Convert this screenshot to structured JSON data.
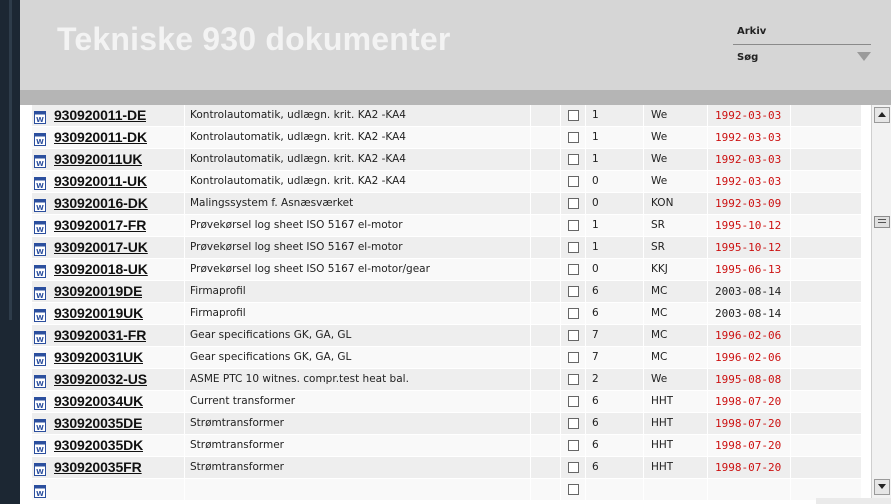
{
  "header": {
    "title": "Tekniske 930 dokumenter",
    "menu": [
      {
        "label": "Arkiv"
      },
      {
        "label": "Søg"
      }
    ]
  },
  "colors": {
    "date_old": "#cc1111",
    "date_new": "#222222",
    "header_bg": "#d6d6d6"
  },
  "documents": [
    {
      "num": "930920011-DE",
      "desc": "Kontrolautomatik, udlægn. krit. KA2 -KA4",
      "rev": "1",
      "initials": "We",
      "date": "1992-03-03",
      "date_color": "red"
    },
    {
      "num": "930920011-DK",
      "desc": "Kontrolautomatik, udlægn. krit. KA2 -KA4",
      "rev": "1",
      "initials": "We",
      "date": "1992-03-03",
      "date_color": "red"
    },
    {
      "num": "930920011UK",
      "desc": "Kontrolautomatik, udlægn. krit. KA2 -KA4",
      "rev": "1",
      "initials": "We",
      "date": "1992-03-03",
      "date_color": "red"
    },
    {
      "num": "930920011-UK",
      "desc": "Kontrolautomatik, udlægn. krit. KA2 -KA4",
      "rev": "0",
      "initials": "We",
      "date": "1992-03-03",
      "date_color": "red"
    },
    {
      "num": "930920016-DK",
      "desc": "Malingssystem f. Asnæsværket",
      "rev": "0",
      "initials": "KON",
      "date": "1992-03-09",
      "date_color": "red"
    },
    {
      "num": "930920017-FR",
      "desc": "Prøvekørsel log sheet ISO 5167 el-motor",
      "rev": "1",
      "initials": "SR",
      "date": "1995-10-12",
      "date_color": "red"
    },
    {
      "num": "930920017-UK",
      "desc": "Prøvekørsel log sheet ISO 5167 el-motor",
      "rev": "1",
      "initials": "SR",
      "date": "1995-10-12",
      "date_color": "red"
    },
    {
      "num": "930920018-UK",
      "desc": "Prøvekørsel log sheet ISO 5167 el-motor/gear",
      "rev": "0",
      "initials": "KKJ",
      "date": "1995-06-13",
      "date_color": "red"
    },
    {
      "num": "930920019DE",
      "desc": "Firmaprofil",
      "rev": "6",
      "initials": "MC",
      "date": "2003-08-14",
      "date_color": "black"
    },
    {
      "num": "930920019UK",
      "desc": "Firmaprofil",
      "rev": "6",
      "initials": "MC",
      "date": "2003-08-14",
      "date_color": "black"
    },
    {
      "num": "930920031-FR",
      "desc": "Gear specifications GK, GA, GL",
      "rev": "7",
      "initials": "MC",
      "date": "1996-02-06",
      "date_color": "red"
    },
    {
      "num": "930920031UK",
      "desc": "Gear specifications GK, GA, GL",
      "rev": "7",
      "initials": "MC",
      "date": "1996-02-06",
      "date_color": "red"
    },
    {
      "num": "930920032-US",
      "desc": "ASME PTC 10 witnes. compr.test heat bal.",
      "rev": "2",
      "initials": "We",
      "date": "1995-08-08",
      "date_color": "red"
    },
    {
      "num": "930920034UK",
      "desc": "Current transformer",
      "rev": "6",
      "initials": "HHT",
      "date": "1998-07-20",
      "date_color": "red"
    },
    {
      "num": "930920035DE",
      "desc": "Strømtransformer",
      "rev": "6",
      "initials": "HHT",
      "date": "1998-07-20",
      "date_color": "red"
    },
    {
      "num": "930920035DK",
      "desc": "Strømtransformer",
      "rev": "6",
      "initials": "HHT",
      "date": "1998-07-20",
      "date_color": "red"
    },
    {
      "num": "930920035FR",
      "desc": "Strømtransformer",
      "rev": "6",
      "initials": "HHT",
      "date": "1998-07-20",
      "date_color": "red"
    }
  ]
}
